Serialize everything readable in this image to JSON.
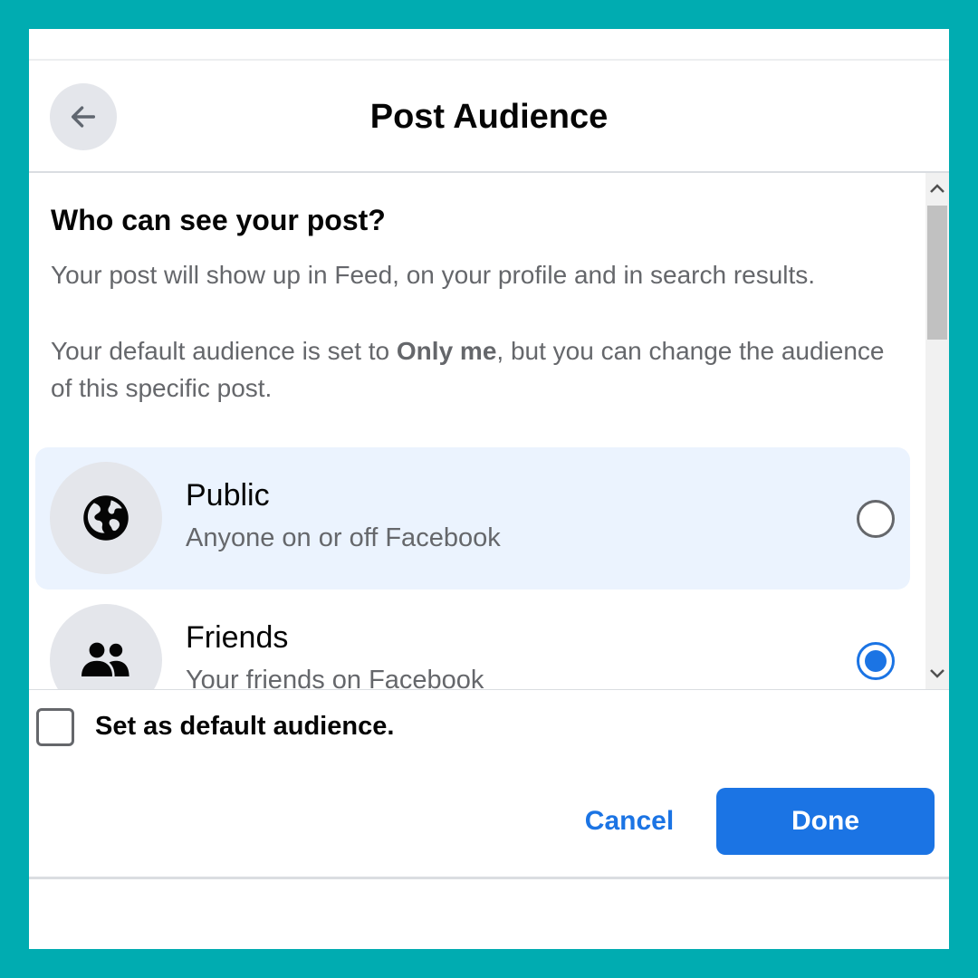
{
  "dialog": {
    "title": "Post Audience",
    "back_icon": "arrow-left-icon"
  },
  "content": {
    "heading": "Who can see your post?",
    "description": "Your post will show up in Feed, on your profile and in search results.",
    "default_note": {
      "prefix": "Your default audience is set to ",
      "bold": "Only me",
      "suffix": ", but you can change the audience of this specific post."
    }
  },
  "options": [
    {
      "id": "public",
      "title": "Public",
      "subtitle": "Anyone on or off Facebook",
      "icon": "globe-icon",
      "selected": false,
      "highlighted": true
    },
    {
      "id": "friends",
      "title": "Friends",
      "subtitle": "Your friends on Facebook",
      "icon": "friends-icon",
      "selected": true,
      "highlighted": false
    }
  ],
  "footer": {
    "default_checkbox_label": "Set as default audience.",
    "default_checked": false,
    "cancel_label": "Cancel",
    "done_label": "Done"
  },
  "colors": {
    "frame": "#00acb1",
    "accent": "#1b74e4",
    "highlight": "#ebf3fe",
    "icon_bg": "#e4e6eb",
    "secondary_text": "#65676b"
  }
}
